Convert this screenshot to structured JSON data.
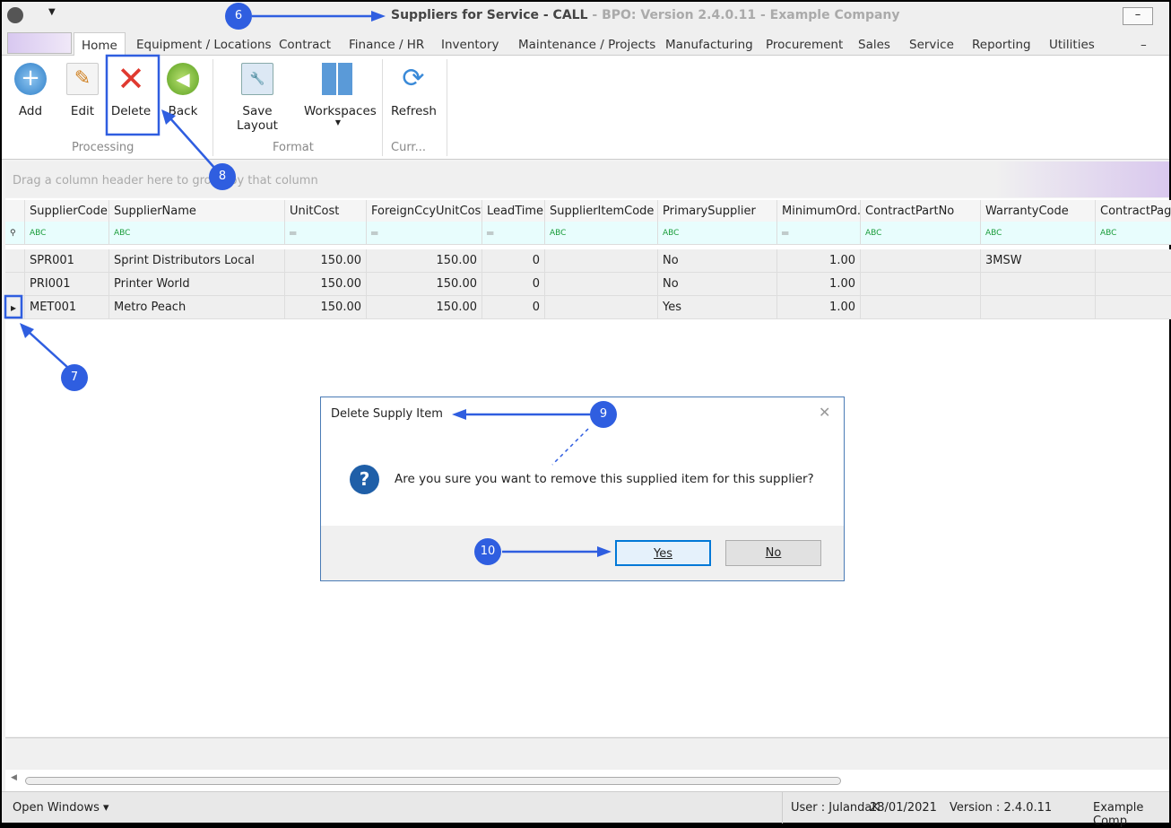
{
  "window": {
    "title_main": "Suppliers for Service - CALL",
    "title_sep": " - ",
    "title_rest": "BPO: Version 2.4.0.11 - Example Company"
  },
  "tabs": [
    "Home",
    "Equipment / Locations",
    "Contract",
    "Finance / HR",
    "Inventory",
    "Maintenance / Projects",
    "Manufacturing",
    "Procurement",
    "Sales",
    "Service",
    "Reporting",
    "Utilities"
  ],
  "ribbon": {
    "buttons": {
      "add": "Add",
      "edit": "Edit",
      "delete": "Delete",
      "back": "Back",
      "save_layout": "Save Layout",
      "workspaces": "Workspaces",
      "refresh": "Refresh"
    },
    "groups": {
      "processing": "Processing",
      "format": "Format",
      "currency": "Curr..."
    }
  },
  "grid": {
    "group_hint": "Drag a column header here to group by that column",
    "columns": [
      "SupplierCode",
      "SupplierName",
      "UnitCost",
      "ForeignCcyUnitCost",
      "LeadTime",
      "SupplierItemCode",
      "PrimarySupplier",
      "MinimumOrd...",
      "ContractPartNo",
      "WarrantyCode",
      "ContractPage"
    ],
    "filter_icons": [
      "abc",
      "abc",
      "=",
      "=",
      "=",
      "abc",
      "abc",
      "=",
      "abc",
      "abc",
      "abc"
    ],
    "rows": [
      [
        "SPR001",
        "Sprint Distributors Local",
        "150.00",
        "150.00",
        "0",
        "",
        "No",
        "1.00",
        "",
        "3MSW",
        ""
      ],
      [
        "PRI001",
        "Printer World",
        "150.00",
        "150.00",
        "0",
        "",
        "No",
        "1.00",
        "",
        "",
        ""
      ],
      [
        "MET001",
        "Metro Peach",
        "150.00",
        "150.00",
        "0",
        "",
        "Yes",
        "1.00",
        "",
        "",
        ""
      ]
    ],
    "selected_row": 2
  },
  "dialog": {
    "title": "Delete Supply Item",
    "message": "Are you sure you want to remove this supplied item for this supplier?",
    "yes": "Yes",
    "no": "No"
  },
  "status": {
    "open_windows": "Open Windows ▾",
    "user": "User : JulandaK",
    "date": "28/01/2021",
    "version": "Version : 2.4.0.11",
    "company": "Example Comp"
  },
  "annotations": [
    "6",
    "7",
    "8",
    "9",
    "10"
  ],
  "colors": {
    "annotation": "#2f5ee0",
    "filter_row": "#e8fdfd",
    "dialog_border": "#4a7bb5"
  }
}
